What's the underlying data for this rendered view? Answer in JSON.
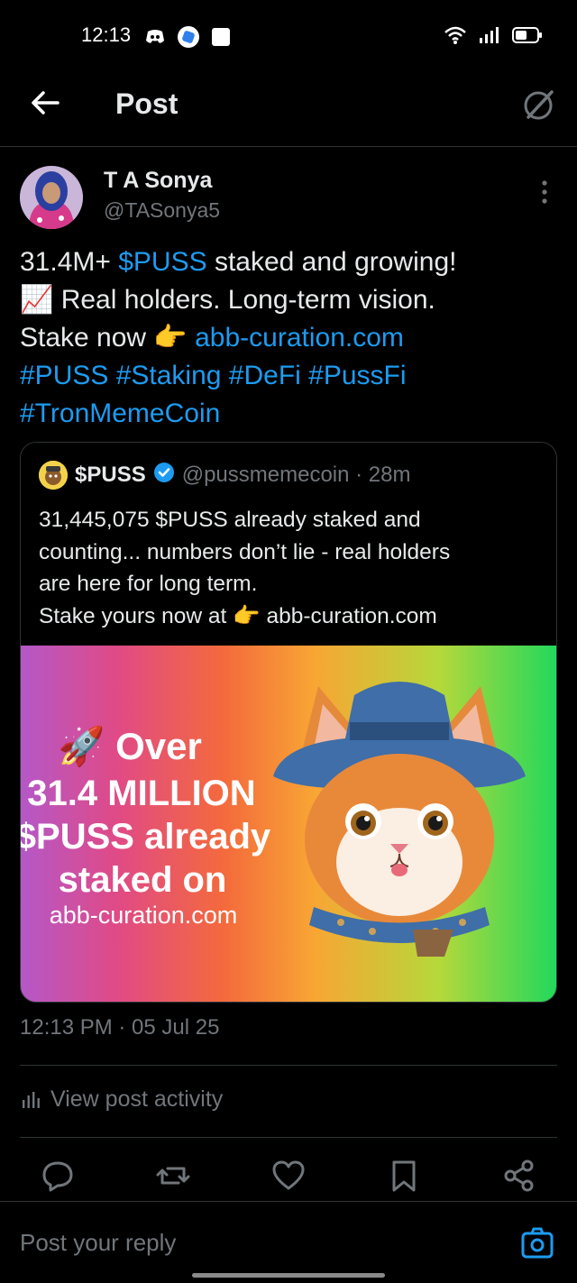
{
  "status_bar": {
    "time": "12:13"
  },
  "header": {
    "title": "Post"
  },
  "author": {
    "name": "T A Sonya",
    "handle": "@TASonya5"
  },
  "tweet": {
    "line1_prefix": "31.4M+ ",
    "line1_link": "$PUSS",
    "line1_suffix": " staked and growing!",
    "line2_emoji": "📈",
    "line2_text": " Real holders. Long-term vision.",
    "line3_prefix": "Stake now ",
    "line3_emoji": "👉",
    "line3_link": " abb-curation.com",
    "hashtags_line1": "#PUSS #Staking #DeFi #PussFi",
    "hashtags_line2": "#TronMemeCoin"
  },
  "quote": {
    "name": "$PUSS",
    "handle_time": "@pussmemecoin · 28m",
    "text_line1": "31,445,075 $PUSS already staked and",
    "text_line2": "counting... numbers don’t lie - real holders",
    "text_line3": "are here for long term.",
    "text_line4_prefix": "Stake yours now at ",
    "text_line4_emoji": "👉",
    "text_line4_suffix": " abb-curation.com",
    "image": {
      "line1": "🚀 Over",
      "line2": "31.4 MILLION",
      "line3": "$PUSS already",
      "line4": "staked on",
      "line5": "abb-curation.com"
    }
  },
  "meta": {
    "timestamp": "12:13 PM · 05 Jul 25",
    "view_activity": "View post activity"
  },
  "reply": {
    "placeholder": "Post your reply"
  },
  "colors": {
    "background": "#000000",
    "link": "#1d9bf0",
    "muted": "#71767b",
    "verified": "#1d9bf0"
  }
}
